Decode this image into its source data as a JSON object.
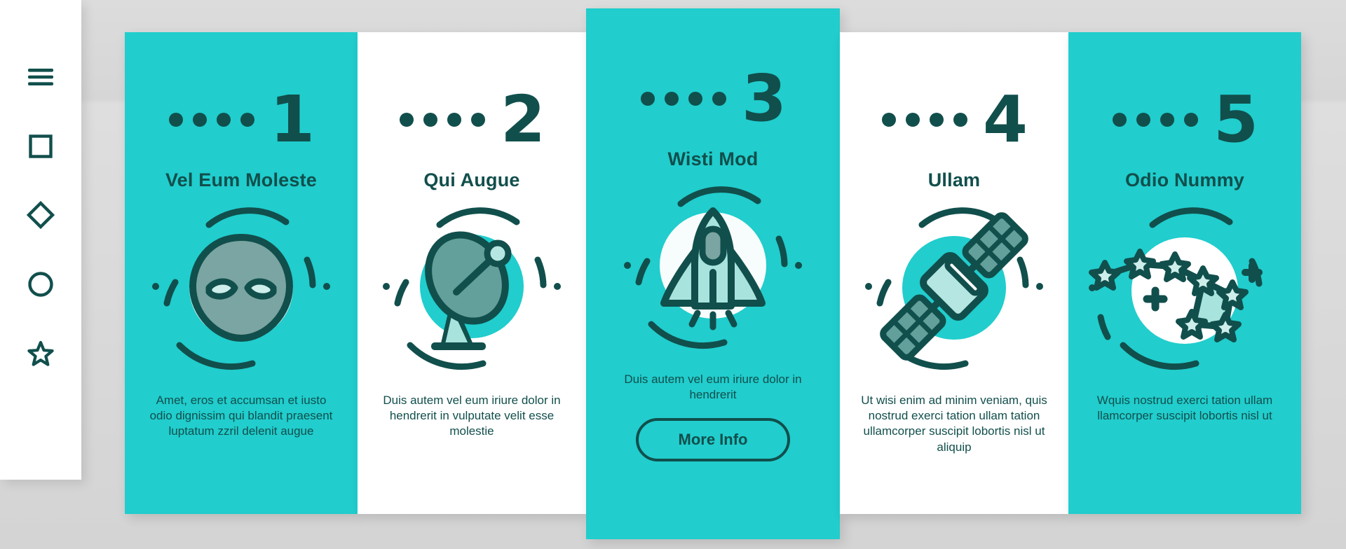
{
  "theme": {
    "teal": "#21cdcd",
    "dark_teal": "#114f4c",
    "white": "#ffffff",
    "mint": "#b6e6e2",
    "grey_green": "#7ba5a2",
    "backdrop": "#d9d9d9"
  },
  "sidebar": {
    "items": [
      {
        "icon": "hamburger-menu-icon",
        "name": "menu"
      },
      {
        "icon": "square-icon",
        "name": "square"
      },
      {
        "icon": "diamond-icon",
        "name": "diamond"
      },
      {
        "icon": "circle-icon",
        "name": "circle"
      },
      {
        "icon": "star-icon",
        "name": "star"
      }
    ]
  },
  "panels": [
    {
      "step": "1",
      "dots": 4,
      "heading": "Vel Eum Moleste",
      "body": "Amet, eros et accumsan et iusto odio dignissim qui blandit praesent luptatum zzril delenit augue",
      "icon": "alien-head-icon",
      "style": "teal",
      "cta": null
    },
    {
      "step": "2",
      "dots": 4,
      "heading": "Qui Augue",
      "body": "Duis autem vel eum iriure dolor in hendrerit in vulputate velit esse molestie",
      "icon": "satellite-dish-icon",
      "style": "white",
      "cta": null
    },
    {
      "step": "3",
      "dots": 4,
      "heading": "Wisti Mod",
      "body": "Duis autem vel eum iriure dolor in hendrerit",
      "icon": "space-shuttle-icon",
      "style": "teal",
      "cta": "More Info"
    },
    {
      "step": "4",
      "dots": 4,
      "heading": "Ullam",
      "body": "Ut wisi enim ad minim veniam, quis nostrud exerci tation ullam tation ullamcorper suscipit lobortis nisl ut aliquip",
      "icon": "satellite-icon",
      "style": "white",
      "cta": null
    },
    {
      "step": "5",
      "dots": 4,
      "heading": "Odio Nummy",
      "body": "Wquis nostrud exerci tation ullam llamcorper suscipit lobortis nisl ut",
      "icon": "constellation-icon",
      "style": "teal",
      "cta": null
    }
  ]
}
